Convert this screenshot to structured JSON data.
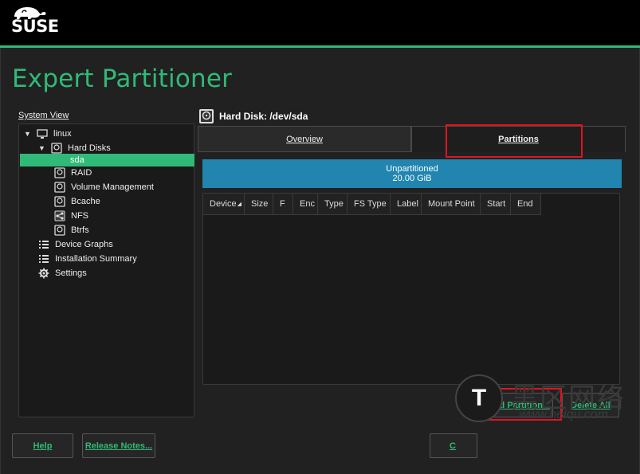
{
  "brand": {
    "logo_text": "SUSE",
    "accent": "#30ba78"
  },
  "title": "Expert Partitioner",
  "system_view": {
    "label": "System View",
    "items": [
      {
        "label": "linux",
        "icon": "monitor-icon",
        "expander": "expanded"
      },
      {
        "label": "Hard Disks",
        "icon": "disk-icon",
        "expander": "expanded"
      },
      {
        "label": "sda",
        "icon": "",
        "selected": true
      },
      {
        "label": "RAID",
        "icon": "disk-icon"
      },
      {
        "label": "Volume Management",
        "icon": "disk-icon"
      },
      {
        "label": "Bcache",
        "icon": "disk-icon"
      },
      {
        "label": "NFS",
        "icon": "share-icon"
      },
      {
        "label": "Btrfs",
        "icon": "disk-icon"
      },
      {
        "label": "Device Graphs",
        "icon": "list-icon"
      },
      {
        "label": "Installation Summary",
        "icon": "list-icon"
      },
      {
        "label": "Settings",
        "icon": "gear-icon"
      }
    ]
  },
  "device": {
    "header": "Hard Disk: /dev/sda"
  },
  "tabs": [
    {
      "label": "Overview",
      "active": false
    },
    {
      "label": "Partitions",
      "active": true
    }
  ],
  "usage_bar": {
    "line1": "Unpartitioned",
    "line2": "20.00 GiB",
    "color": "#2185b0"
  },
  "table": {
    "columns": [
      "Device",
      "Size",
      "F",
      "Enc",
      "Type",
      "FS Type",
      "Label",
      "Mount Point",
      "Start",
      "End"
    ],
    "rows": []
  },
  "actions": {
    "add_partition": "Add Partition...",
    "delete_all": "Delete All"
  },
  "footer": {
    "help": "Help",
    "release_notes": "Release Notes...",
    "cancel_partial": "C"
  },
  "watermark": {
    "glyph": "T",
    "text": "黑区网络",
    "domain": "www.heiqu.com"
  }
}
